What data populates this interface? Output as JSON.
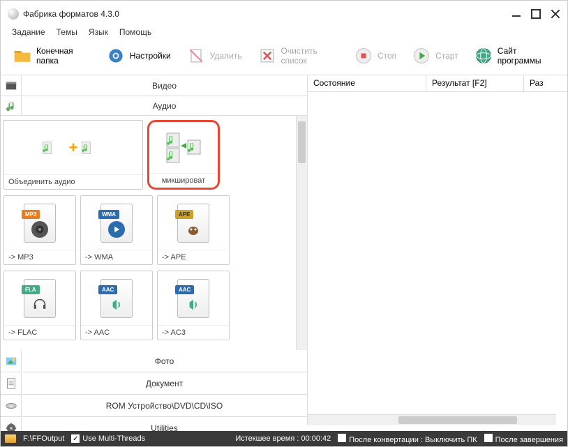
{
  "window": {
    "title": "Фабрика форматов 4.3.0"
  },
  "menu": {
    "task": "Задание",
    "themes": "Темы",
    "lang": "Язык",
    "help": "Помощь"
  },
  "toolbar": {
    "output_folder": "Конечная папка",
    "settings": "Настройки",
    "delete": "Удалить",
    "clear_list": "Очистить список",
    "stop": "Стоп",
    "start": "Старт",
    "site": "Сайт программы"
  },
  "categories": {
    "video": "Видео",
    "audio": "Аудио",
    "photo": "Фото",
    "document": "Документ",
    "rom": "ROM Устройство\\DVD\\CD\\ISO",
    "utilities": "Utilities"
  },
  "tiles": {
    "join_audio": "Объединить аудио",
    "mix": "микшироват",
    "mp3": "-> MP3",
    "wma": "-> WMA",
    "ape": "-> APE",
    "flac": "-> FLAC",
    "aac": "-> AAC",
    "ac3": "-> AC3",
    "badges": {
      "mp3": "MP3",
      "wma": "WMA",
      "ape": "APE",
      "fla": "FLA",
      "aac": "AAC",
      "aac2": "AAC"
    }
  },
  "columns": {
    "state": "Состояние",
    "result": "Результат [F2]",
    "size": "Раз"
  },
  "status": {
    "output_path": "F:\\FFOutput",
    "multi_threads": "Use Multi-Threads",
    "elapsed": "Истекшее время : 00:00:42",
    "after_conv": "После конвертации : Выключить ПК",
    "after_done": "После завершения"
  }
}
